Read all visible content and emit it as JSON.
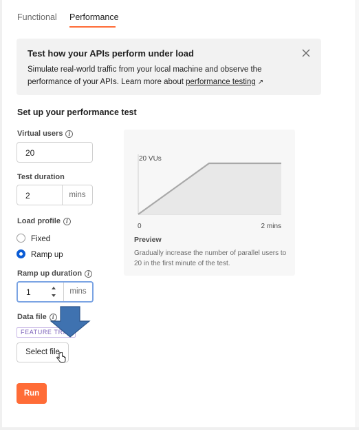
{
  "tabs": [
    {
      "label": "Functional",
      "active": false
    },
    {
      "label": "Performance",
      "active": true
    }
  ],
  "banner": {
    "title": "Test how your APIs perform under load",
    "text_line1": "Simulate real-world traffic from your local machine and observe the",
    "text_line2_prefix": "performance of your APIs. Learn more about ",
    "link_text": "performance testing",
    "link_arrow": "↗",
    "close_icon": "close-icon"
  },
  "section_title": "Set up your performance test",
  "virtual_users": {
    "label": "Virtual users",
    "value": "20",
    "info_icon": "info-icon"
  },
  "test_duration": {
    "label": "Test duration",
    "value": "2",
    "unit": "mins"
  },
  "load_profile": {
    "label": "Load profile",
    "options": [
      {
        "label": "Fixed",
        "checked": false
      },
      {
        "label": "Ramp up",
        "checked": true
      }
    ]
  },
  "ramp_up_duration": {
    "label": "Ramp up duration",
    "value": "1",
    "unit": "mins"
  },
  "data_file": {
    "label": "Data file",
    "badge": "FEATURE TRIAL",
    "button": "Select file"
  },
  "run_button": "Run",
  "preview": {
    "title": "Preview",
    "description": "Gradually increase the number of parallel users to 20 in the first minute of the test.",
    "y_label": "20 VUs",
    "x_start": "0",
    "x_end": "2 mins"
  },
  "colors": {
    "accent": "#ff6c37",
    "radio_checked": "#0b5cd5",
    "focus_border": "#7ba4e3",
    "overlay_arrow": "#3f72b0"
  },
  "chart_data": {
    "type": "area",
    "x": [
      0,
      1,
      2
    ],
    "y": [
      0,
      20,
      20
    ],
    "xlabel": "",
    "ylabel": "",
    "tick_labels_x": [
      "0",
      "2 mins"
    ],
    "tick_labels_y": [
      "20 VUs"
    ],
    "xlim": [
      0,
      2
    ],
    "ylim": [
      0,
      20
    ]
  }
}
